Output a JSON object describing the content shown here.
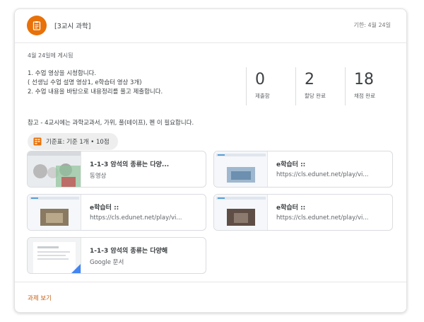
{
  "card": {
    "title": "[3교시 과학]",
    "due": "기한: 4월 24일",
    "posted": "4월 24일에 게시됨",
    "instructions": [
      "1. 수업 영상을 시청합니다.",
      "( 선생님 수업 설명 영상1, e학습터 영상 3개)",
      "2. 수업 내용을 바탕으로 내용정리를 풀고 제출합니다."
    ],
    "note": "참고 - 4교시에는 과학교과서, 가위, 풀(테이프), 펜 이 필요합니다.",
    "rubric": "기준표: 기준 1개 • 10점",
    "footer_link": "과제 보기"
  },
  "stats": [
    {
      "value": "0",
      "label": "제출함"
    },
    {
      "value": "2",
      "label": "할당 완료"
    },
    {
      "value": "18",
      "label": "채점 완료"
    }
  ],
  "attachments": [
    {
      "title": "1-1-3 암석의 종류는 다양...",
      "sub": "동영상"
    },
    {
      "title": "e학습터 ::",
      "sub": "https://cls.edunet.net/play/vi..."
    },
    {
      "title": "e학습터 ::",
      "sub": "https://cls.edunet.net/play/vi..."
    },
    {
      "title": "e학습터 ::",
      "sub": "https://cls.edunet.net/play/vi..."
    },
    {
      "title": "1-1-3 암석의 종류는 다양해",
      "sub": "Google 문서"
    }
  ],
  "colors": {
    "accent": "#e8710a",
    "link": "#c5621a"
  }
}
